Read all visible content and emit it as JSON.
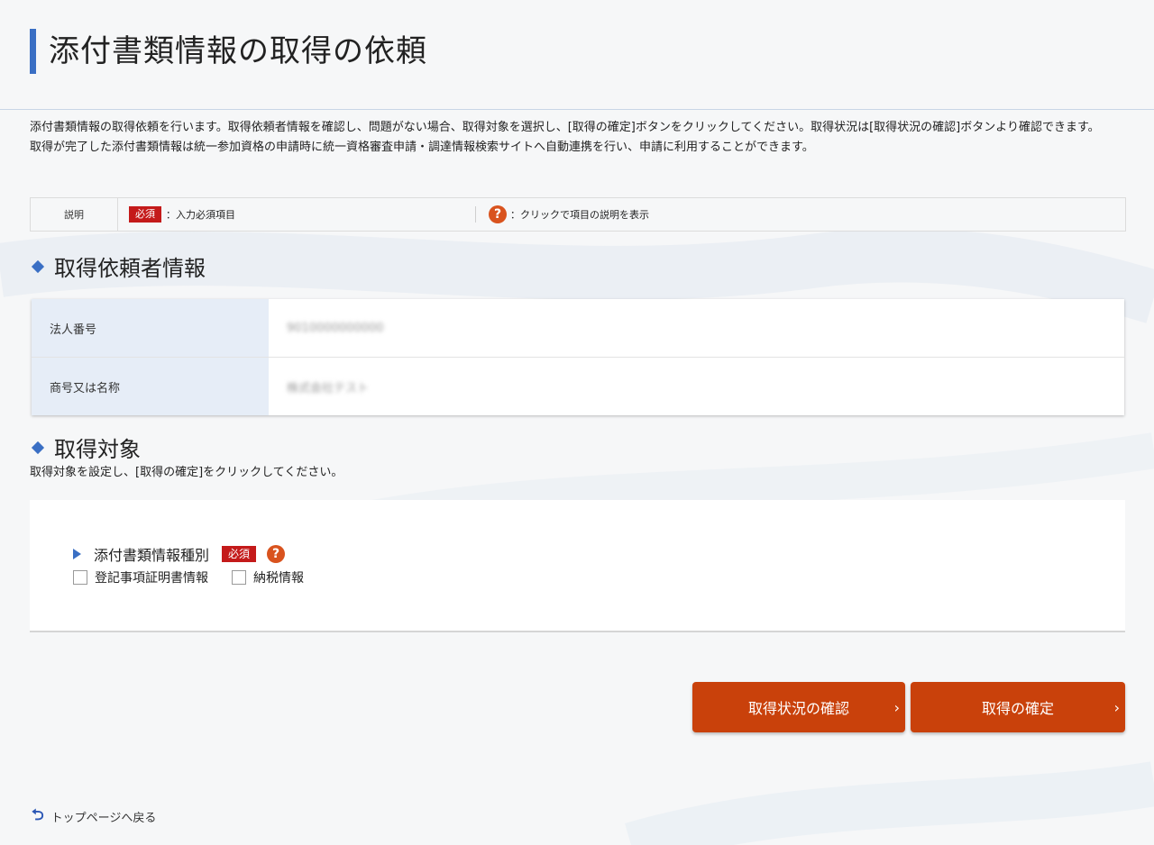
{
  "header": {
    "title": "添付書類情報の取得の依頼"
  },
  "intro": {
    "line1": "添付書類情報の取得依頼を行います。取得依頼者情報を確認し、問題がない場合、取得対象を選択し、[取得の確定]ボタンをクリックしてください。取得状況は[取得状況の確認]ボタンより確認できます。",
    "line2": "取得が完了した添付書類情報は統一参加資格の申請時に統一資格審査申請・調達情報検索サイトへ自動連携を行い、申請に利用することができます。"
  },
  "legend": {
    "label": "説明",
    "required_badge": "必須",
    "required_text": "：入力必須項目",
    "help_icon": "?",
    "help_text": "：クリックで項目の説明を表示"
  },
  "requester": {
    "heading": "取得依頼者情報",
    "rows": [
      {
        "label": "法人番号",
        "value": "9010000000000"
      },
      {
        "label": "商号又は名称",
        "value": "株式会社テスト"
      }
    ]
  },
  "target": {
    "heading": "取得対象",
    "description": "取得対象を設定し、[取得の確定]をクリックしてください。",
    "field_label": "添付書類情報種別",
    "required_badge": "必須",
    "help_icon": "?",
    "options": [
      "登記事項証明書情報",
      "納税情報"
    ]
  },
  "buttons": {
    "status": "取得状況の確認",
    "confirm": "取得の確定",
    "chevron": "›"
  },
  "footer": {
    "back_arrow": "⮌",
    "back_label": "トップページへ戻る"
  },
  "colors": {
    "accent": "#3a6fc4",
    "button": "#c9410b",
    "required": "#c41a1a",
    "help": "#d9531e"
  }
}
